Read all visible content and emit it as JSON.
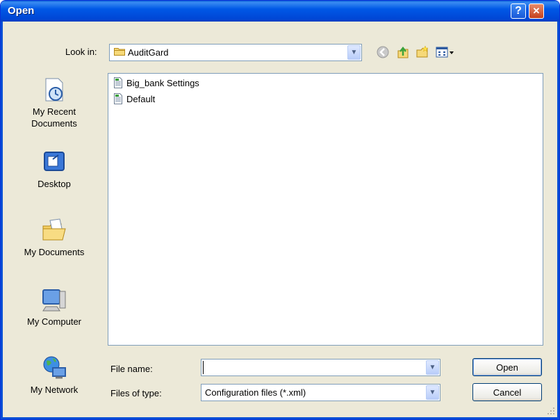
{
  "window": {
    "title": "Open"
  },
  "title_buttons": {
    "help": "?",
    "close": "✕"
  },
  "look_in": {
    "label": "Look in:",
    "value": "AuditGard"
  },
  "toolbar_icons": [
    "back-icon",
    "up-folder-icon",
    "new-folder-icon",
    "views-menu-icon"
  ],
  "places": [
    {
      "label_line1": "My Recent",
      "label_line2": "Documents",
      "icon": "recent-documents-icon"
    },
    {
      "label_line1": "Desktop",
      "label_line2": "",
      "icon": "desktop-icon"
    },
    {
      "label_line1": "My Documents",
      "label_line2": "",
      "icon": "my-documents-icon"
    },
    {
      "label_line1": "My Computer",
      "label_line2": "",
      "icon": "my-computer-icon"
    },
    {
      "label_line1": "My Network",
      "label_line2": "",
      "icon": "my-network-icon"
    }
  ],
  "files": [
    {
      "name": "Big_bank Settings",
      "icon": "xml-file-icon"
    },
    {
      "name": "Default",
      "icon": "xml-file-icon"
    }
  ],
  "file_name": {
    "label": "File name:",
    "value": ""
  },
  "file_type": {
    "label": "Files of type:",
    "value": "Configuration files (*.xml)"
  },
  "buttons": {
    "open": "Open",
    "cancel": "Cancel"
  },
  "colors": {
    "titlebar": "#0058e6",
    "dialog_bg": "#ece9d8",
    "border": "#7f9db9"
  }
}
